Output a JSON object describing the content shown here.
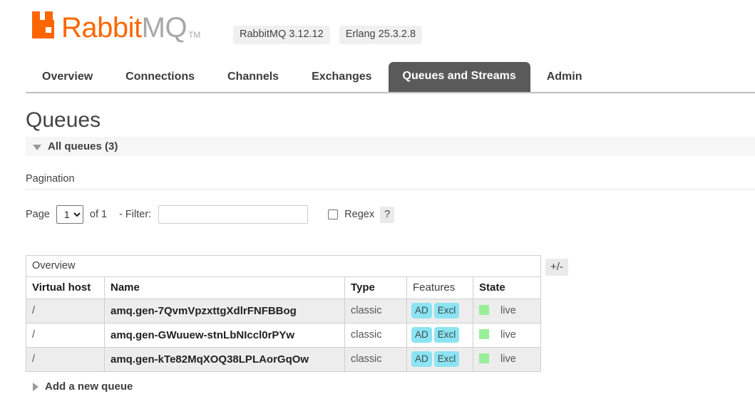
{
  "header": {
    "logo_primary": "Rabbit",
    "logo_secondary": "MQ",
    "logo_tm": "TM",
    "logo_icon": "rabbitmq-logo-icon",
    "brand_color": "#ff6600",
    "versions": [
      {
        "label": "RabbitMQ 3.12.12"
      },
      {
        "label": "Erlang 25.3.2.8"
      }
    ]
  },
  "nav": {
    "tabs": [
      {
        "label": "Overview",
        "active": false
      },
      {
        "label": "Connections",
        "active": false
      },
      {
        "label": "Channels",
        "active": false
      },
      {
        "label": "Exchanges",
        "active": false
      },
      {
        "label": "Queues and Streams",
        "active": true
      },
      {
        "label": "Admin",
        "active": false
      }
    ],
    "active_tab_color": "#5a5a5a"
  },
  "page": {
    "title": "Queues",
    "section_label": "All queues (3)",
    "section_expanded": true
  },
  "pagination": {
    "title": "Pagination",
    "page_label": "Page",
    "page_value": "1",
    "page_options": [
      "1"
    ],
    "of_label": "of 1",
    "filter_label": "- Filter:",
    "filter_value": "",
    "filter_placeholder": "",
    "regex_label": "Regex",
    "regex_checked": false,
    "help_label": "?"
  },
  "table": {
    "group_header": "Overview",
    "toggle_columns_label": "+/-",
    "columns": [
      {
        "label": "Virtual host",
        "sortable": true
      },
      {
        "label": "Name",
        "sortable": true
      },
      {
        "label": "Type",
        "sortable": true
      },
      {
        "label": "Features",
        "sortable": false
      },
      {
        "label": "State",
        "sortable": true
      }
    ],
    "rows": [
      {
        "vhost": "/",
        "name": "amq.gen-7QvmVpzxttgXdlrFNFBBog",
        "type": "classic",
        "features": [
          "AD",
          "Excl"
        ],
        "state": "live",
        "state_color": "#99ee99"
      },
      {
        "vhost": "/",
        "name": "amq.gen-GWuuew-stnLbNIccl0rPYw",
        "type": "classic",
        "features": [
          "AD",
          "Excl"
        ],
        "state": "live",
        "state_color": "#99ee99"
      },
      {
        "vhost": "/",
        "name": "amq.gen-kTe82MqXOQ38LPLAorGqOw",
        "type": "classic",
        "features": [
          "AD",
          "Excl"
        ],
        "state": "live",
        "state_color": "#99ee99"
      }
    ]
  },
  "footer": {
    "add_queue_label": "Add a new queue",
    "add_queue_expanded": false
  }
}
